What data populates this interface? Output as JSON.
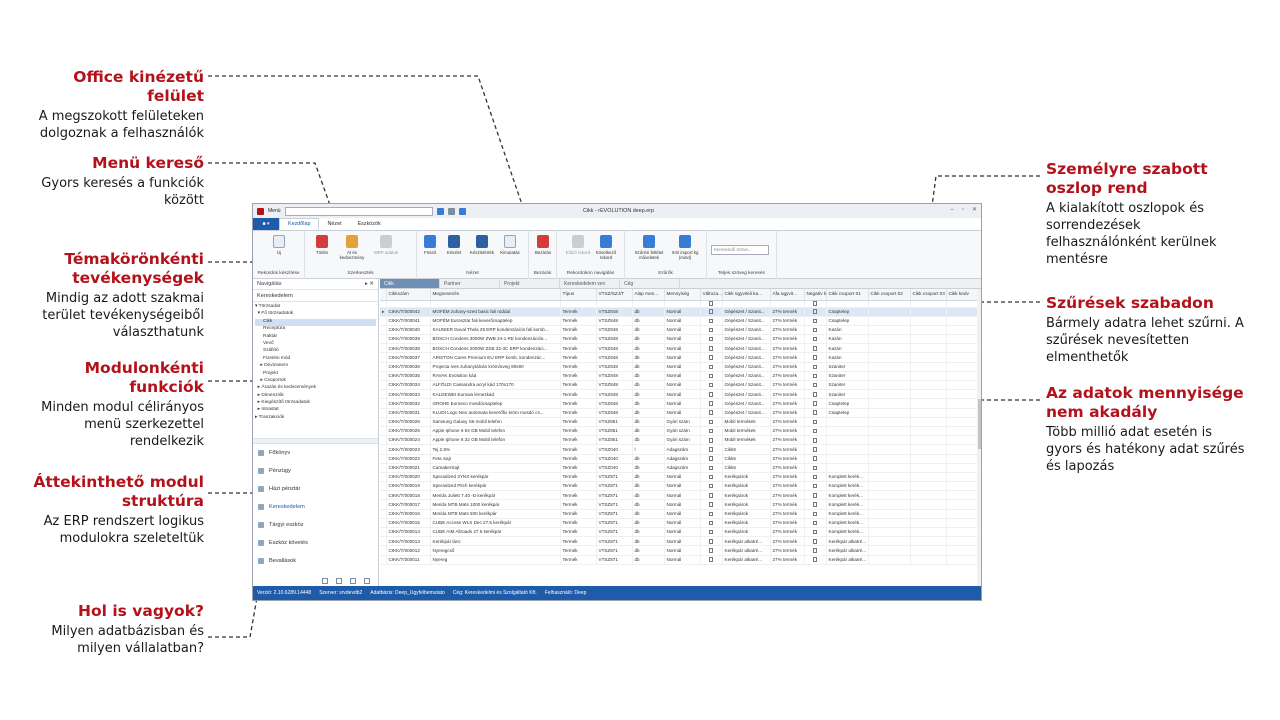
{
  "callouts": {
    "office": {
      "title": "Office kinézetű felület",
      "desc": "A megszokott felületeken dolgoznak a felhasználók"
    },
    "menu": {
      "title": "Menü kereső",
      "desc": "Gyors keresés a funkciók között"
    },
    "tema": {
      "title": "Témakörönkénti tevékenységek",
      "desc": "Mindig az adott szakmai terület tevékenységeiből választhatunk"
    },
    "modul": {
      "title": "Modulonkénti funkciók",
      "desc": "Minden modul célirányos menü szerkezettel rendelkezik"
    },
    "atteki": {
      "title": "Áttekinthető modul struktúra",
      "desc": "Az ERP rendszert logikus modulokra szeleteltük"
    },
    "hol": {
      "title": "Hol is vagyok?",
      "desc": "Milyen adatbázisban és milyen vállalatban?"
    },
    "szemely": {
      "title": "Személyre szabott oszlop rend",
      "desc": "A kialakított oszlopok és sorrendezések felhasználónként kerülnek mentésre"
    },
    "szuro": {
      "title": "Szűrések szabadon",
      "desc": "Bármely adatra lehet szűrni. A szűrések nevesítetten elmenthetők"
    },
    "mennyiseg": {
      "title": "Az adatok mennyisége nem akadály",
      "desc": "Több millió adat esetén is gyors és hatékony adat szűrés és lapozás"
    }
  },
  "app": {
    "title": "Cikk - rEVOLUTION deep.erp",
    "menu_label": "Menü",
    "file_label": "■ ▾",
    "ribbon_tabs": [
      "Kezdőlap",
      "Nézet",
      "Eszközök"
    ],
    "groups": [
      {
        "label": "Rekordok készítése",
        "buttons": [
          "Új"
        ]
      },
      {
        "label": "Szerkesztés",
        "buttons": [
          "Törlés",
          "Át és kedvezmény",
          "MRP adatok"
        ]
      },
      {
        "label": "Nézet",
        "buttons": [
          "Frissít",
          "Készlet",
          "Készletérték",
          "Kimutatás"
        ]
      },
      {
        "label": "Bezárás",
        "buttons": [
          "Bezárás"
        ]
      },
      {
        "label": "Rekordokon navigálás",
        "buttons": [
          "Előző rekord",
          "Következő rekord"
        ]
      },
      {
        "label": "Szűrők",
        "buttons": [
          "Szűrési feltétel műveletek",
          "Xml import kg (mind)"
        ]
      },
      {
        "label": "Teljes szöveg keresés",
        "buttons": []
      }
    ],
    "search_placeholder": "Keresendő szöve...",
    "nav_header": "Navigálás",
    "nav_section": "Kereskedelem",
    "tree": [
      "▾ Törzsadat",
      "  ▾ Fő törzsadatok",
      "      Cikk",
      "      Receptúra",
      "      Raktár",
      "      Vevő",
      "      Szállító",
      "      Fizetési mód",
      "    ▸ Devizanem",
      "      Projekt",
      "    ▸ Csoportok",
      "  ▸ Árazás és kedvezmények",
      "  ▸ Dimenziók",
      "  ▸ Kiegészítő törzsadatok",
      "  ▸ Intrastat",
      "▸ Tranzakciók"
    ],
    "modules": [
      "Főkönyv",
      "Pénzügy",
      "Házi pénztár",
      "Kereskedelem",
      "Tárgyi eszköz",
      "Eszköz követés",
      "Bevallások"
    ],
    "doc_tabs": [
      "Cikk",
      "Partner",
      "Projekt",
      "Kereskedelem vev",
      "Cég"
    ],
    "columns": [
      "",
      "Cikkszám",
      "Megnevezés",
      "Típus",
      "VTSZ/SZJ/T",
      "Alap men...",
      "Mennyiség",
      "Változa...",
      "Cikk ügyviteli ka...",
      "Áfa ügyvit...",
      "Negatív k...",
      "Cikk csoport 01",
      "Cikk csoport 02",
      "Cikk csoport 03",
      "Cikk kedv"
    ],
    "rows": [
      [
        "▸",
        "CIKK/T/000042",
        "MOFÉM zuhany-szett basic fali rúddal",
        "Termék",
        "VTSZ848",
        "db",
        "Normál",
        "",
        "Gépészet / Szanit...",
        "27% termék",
        "",
        "Csaptelep"
      ],
      [
        "",
        "CIKK/T/000041",
        "MOFÉM Eurosztár fali keverőcsaptelep",
        "Termék",
        "VTSZ848",
        "db",
        "Normál",
        "",
        "Gépészet / Szanit...",
        "27% termék",
        "",
        "Csaptelep"
      ],
      [
        "",
        "CIKK/T/000040",
        "SAUNIER Duval Thela 25 ERP kondenzációs fali komb...",
        "Termék",
        "VTSZ848",
        "db",
        "Normál",
        "",
        "Gépészet / Szanit...",
        "27% termék",
        "",
        "Kazán"
      ],
      [
        "",
        "CIKK/T/000039",
        "BOSCH Condens 3000W ZWB 24-1 RE kondenzációs...",
        "Termék",
        "VTSZ848",
        "db",
        "Normál",
        "",
        "Gépészet / Szanit...",
        "27% termék",
        "",
        "Kazán"
      ],
      [
        "",
        "CIKK/T/000038",
        "BOSCH Condens 2000W ZSB 22-3C ERP kondenzáci...",
        "Termék",
        "VTSZ848",
        "db",
        "Normál",
        "",
        "Gépészet / Szanit...",
        "27% termék",
        "",
        "Kazán"
      ],
      [
        "",
        "CIKK/T/000037",
        "ARISTON Cares Premium EU ERP komb. kondenzác...",
        "Termék",
        "VTSZ848",
        "db",
        "Normál",
        "",
        "Gépészet / Szanit...",
        "27% termék",
        "",
        "Kazán"
      ],
      [
        "",
        "CIKK/T/000036",
        "Projecta ives zuhanytálcán króm/üveg 90x90",
        "Termék",
        "VTSZ848",
        "db",
        "Normál",
        "",
        "Gépészet / Szanit...",
        "27% termék",
        "",
        "Szaniter"
      ],
      [
        "",
        "CIKK/T/000035",
        "RAVAK Evolution kád",
        "Termék",
        "VTSZ848",
        "db",
        "Normál",
        "",
        "Gépészet / Szanit...",
        "27% termék",
        "",
        "Szaniter"
      ],
      [
        "",
        "CIKK/T/000034",
        "ALFÖLDI Cassandra acryl kád 170x170",
        "Termék",
        "VTSZ848",
        "db",
        "Normál",
        "",
        "Gépészet / Szanit...",
        "27% termék",
        "",
        "Szaniter"
      ],
      [
        "",
        "CIKK/T/000033",
        "KALDEWEI Eurowa lemezkád",
        "Termék",
        "VTSZ848",
        "db",
        "Normál",
        "",
        "Gépészet / Szanit...",
        "27% termék",
        "",
        "Szaniter"
      ],
      [
        "",
        "CIKK/T/000032",
        "GROHE Euroeco mosdócsaptelep",
        "Termék",
        "VTSZ848",
        "db",
        "Normál",
        "",
        "Gépészet / Szanit...",
        "27% termék",
        "",
        "Csaptelep"
      ],
      [
        "",
        "CIKK/T/000031",
        "KLUDI Logo Neo automata keverőfix króm mosdó cs...",
        "Termék",
        "VTSZ848",
        "db",
        "Normál",
        "",
        "Gépészet / Szanit...",
        "27% termék",
        "",
        "Csaptelep"
      ],
      [
        "",
        "CIKK/T/000026",
        "Samsung Galaxy S6 mobil telefon",
        "Termék",
        "VTSZ851",
        "db",
        "Gyári szám",
        "",
        "Mobil termékek",
        "27% termék",
        "",
        ""
      ],
      [
        "",
        "CIKK/T/000025",
        "Apple Iphone 6 64 GB Mobil telefon",
        "Termék",
        "VTSZ851",
        "db",
        "Gyári szám",
        "",
        "Mobil termékek",
        "27% termék",
        "",
        ""
      ],
      [
        "",
        "CIKK/T/000024",
        "Apple Iphone 6 32 GB Mobil telefon",
        "Termék",
        "VTSZ851",
        "db",
        "Gyári szám",
        "",
        "Mobil termékek",
        "27% termék",
        "",
        ""
      ],
      [
        "",
        "CIKK/T/000023",
        "Tej 2.8%",
        "Termék",
        "VTSZ040",
        "l",
        "Adagszám",
        "",
        "Cikk5",
        "27% termék",
        "",
        ""
      ],
      [
        "",
        "CIKK/T/000022",
        "Feta Sajt",
        "Termék",
        "VTSZ040",
        "db",
        "Adagszám",
        "",
        "Cikk5",
        "27% termék",
        "",
        ""
      ],
      [
        "",
        "CIKK/T/000021",
        "CamaberSajt",
        "Termék",
        "VTSZ040",
        "db",
        "Adagszám",
        "",
        "Cikk5",
        "27% termék",
        "",
        ""
      ],
      [
        "",
        "CIKK/T/000020",
        "Specialized 3YNX kerékpár",
        "Termék",
        "VTSZ871",
        "db",
        "Normál",
        "",
        "Kerékpárok",
        "27% termék",
        "",
        "Komplett kerék..."
      ],
      [
        "",
        "CIKK/T/000019",
        "Specialized Pitch kerékpár",
        "Termék",
        "VTSZ871",
        "db",
        "Normál",
        "",
        "Kerékpárok",
        "27% termék",
        "",
        "Komplett kerék..."
      ],
      [
        "",
        "CIKK/T/000018",
        "Merida Juliett 7.40 -D kerékpár",
        "Termék",
        "VTSZ871",
        "db",
        "Normál",
        "",
        "Kerékpárok",
        "27% termék",
        "",
        "Komplett kerék..."
      ],
      [
        "",
        "CIKK/T/000017",
        "Merida MTB Mats 1000 kerékpár",
        "Termék",
        "VTSZ871",
        "db",
        "Normál",
        "",
        "Kerékpárok",
        "27% termék",
        "",
        "Komplett kerék..."
      ],
      [
        "",
        "CIKK/T/000016",
        "Merida MTB Mats 500 kerékpár",
        "Termék",
        "VTSZ871",
        "db",
        "Normál",
        "",
        "Kerékpárok",
        "27% termék",
        "",
        "Komplett kerék..."
      ],
      [
        "",
        "CIKK/T/000015",
        "CUBE Access WLS Dec 27.5 kerékpár",
        "Termék",
        "VTSZ871",
        "db",
        "Normál",
        "",
        "Kerékpárok",
        "27% termék",
        "",
        "Komplett kerék..."
      ],
      [
        "",
        "CIKK/T/000014",
        "CUBE AIM Allroads 27.5 kerékpár",
        "Termék",
        "VTSZ871",
        "db",
        "Normál",
        "",
        "Kerékpárok",
        "27% termék",
        "",
        "Komplett kerék..."
      ],
      [
        "",
        "CIKK/T/000013",
        "Kerékpár lánc",
        "Termék",
        "VTSZ871",
        "db",
        "Normál",
        "",
        "Kerékpár alkatré...",
        "27% termék",
        "",
        "Kerékpár alkatré..."
      ],
      [
        "",
        "CIKK/T/000012",
        "Nyeregcső",
        "Termék",
        "VTSZ871",
        "db",
        "Normál",
        "",
        "Kerékpár alkatré...",
        "27% termék",
        "",
        "Kerékpár alkatré..."
      ],
      [
        "",
        "CIKK/T/000011",
        "Nyereg",
        "Termék",
        "VTSZ871",
        "db",
        "Normál",
        "",
        "Kerékpár alkatré...",
        "27% termék",
        "",
        "Kerékpár alkatré..."
      ]
    ],
    "status": [
      "Verzió: 2.10.6289.14448",
      "Szerver: srvdevdb2",
      "Adatbázis: Deep_Ugyfelbemutato",
      "Cég: Kereskedelmi és Szolgáltató Kft.",
      "Felhasználó: Deep"
    ]
  },
  "colors": {
    "accent": "#b3121a",
    "brand": "#1e5ba8"
  }
}
